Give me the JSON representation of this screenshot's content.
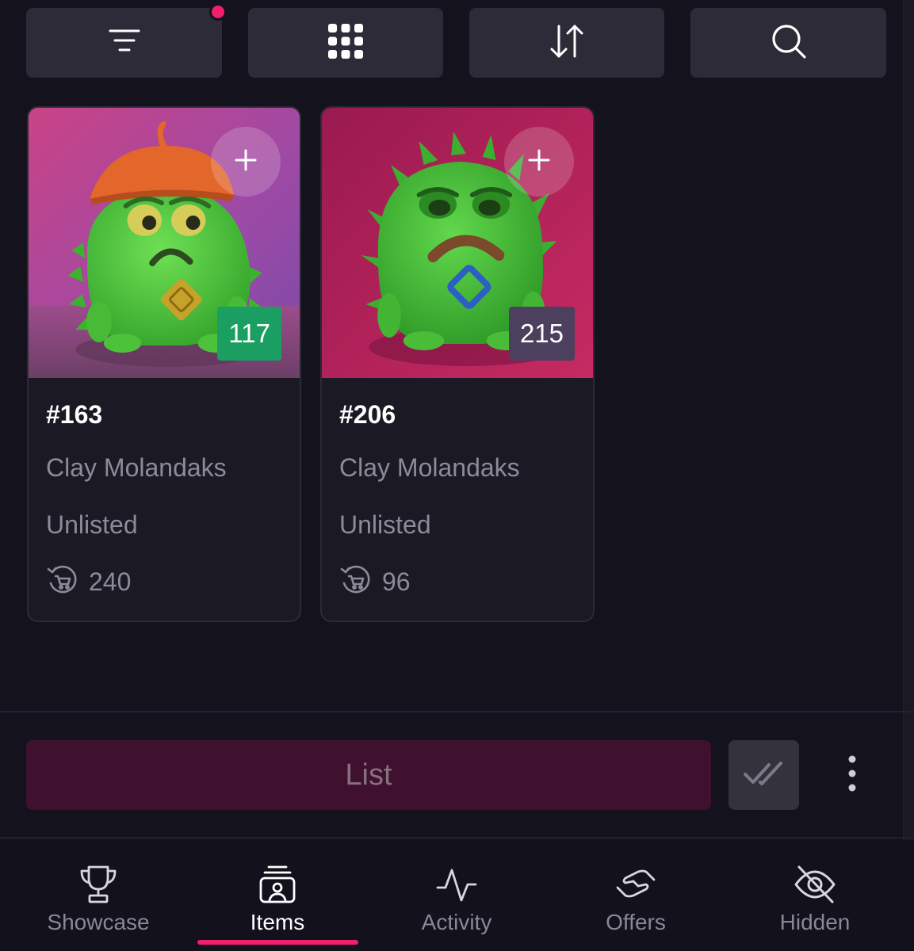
{
  "toolbar": {
    "buttons": [
      {
        "icon": "filter-icon",
        "has_notification": true
      },
      {
        "icon": "grid-icon"
      },
      {
        "icon": "sort-icon"
      },
      {
        "icon": "search-icon"
      }
    ],
    "notification_color": "#f0216a"
  },
  "cards": [
    {
      "token_id": "#163",
      "collection": "Clay Molandaks",
      "status": "Unlisted",
      "rank": "117",
      "rank_color": "#1b9e62",
      "rewards": "240",
      "add_icon": "plus-icon",
      "rewards_icon": "cart-cycle-icon",
      "image_description_colors": {
        "bg_top": "#c94386",
        "bg_right": "#7f4ab0",
        "body": "#4fcb3c",
        "hat": "#e3662a"
      }
    },
    {
      "token_id": "#206",
      "collection": "Clay Molandaks",
      "status": "Unlisted",
      "rank": "215",
      "rank_color": "#4d3f5e",
      "rewards": "96",
      "add_icon": "plus-icon",
      "rewards_icon": "cart-cycle-icon",
      "image_description_colors": {
        "bg_top": "#a01a52",
        "bg_right": "#c3275f",
        "body": "#47c43a",
        "gem": "#2b5fc4"
      }
    }
  ],
  "actions": {
    "list_label": "List",
    "select_all_icon": "double-check-icon",
    "more_icon": "vertical-dots-icon",
    "list_bg": "#40112e"
  },
  "nav": {
    "items": [
      {
        "label": "Showcase",
        "icon": "trophy-icon",
        "active": false
      },
      {
        "label": "Items",
        "icon": "items-stack-icon",
        "active": true
      },
      {
        "label": "Activity",
        "icon": "activity-pulse-icon",
        "active": false
      },
      {
        "label": "Offers",
        "icon": "handshake-icon",
        "active": false
      },
      {
        "label": "Hidden",
        "icon": "eye-off-icon",
        "active": false
      }
    ],
    "active_color": "#f0216a"
  }
}
